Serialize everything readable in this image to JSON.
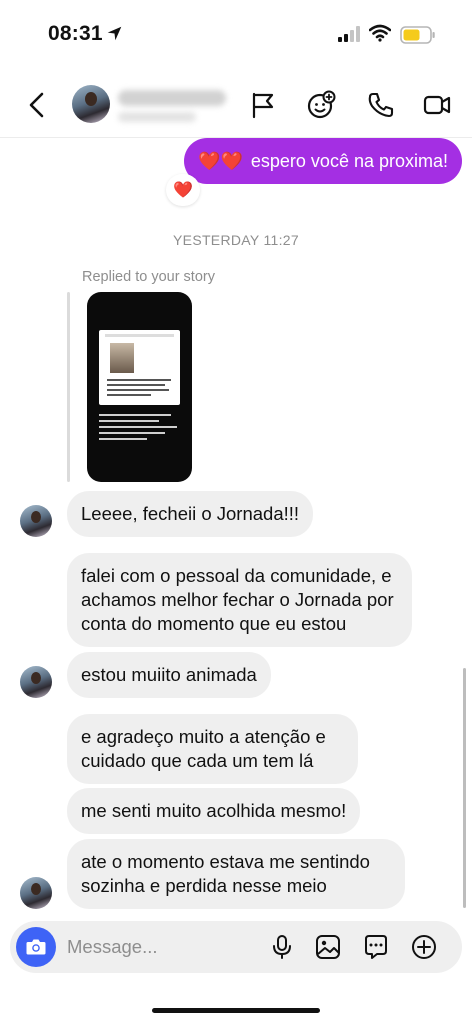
{
  "status": {
    "time": "08:31"
  },
  "header": {
    "back_label": "back"
  },
  "messages": {
    "sent_text": "espero você na proxima!",
    "sent_hearts": "❤️❤️",
    "reaction": "❤️",
    "timestamp": "YESTERDAY 11:27",
    "replied_label": "Replied to your story",
    "received": [
      "Leeee, fecheii o Jornada!!!",
      "falei com o pessoal da comunidade, e achamos melhor fechar o Jornada por conta do momento que eu estou",
      "estou muiito animada",
      "e agradeço muito a atenção e cuidado que cada um tem lá",
      "me senti muito acolhida mesmo!",
      "ate o momento estava me sentindo sozinha e perdida nesse meio"
    ]
  },
  "composer": {
    "placeholder": "Message..."
  },
  "colors": {
    "sent_bubble": "#a42fe3",
    "received_bubble": "#efefef",
    "camera_button": "#3e63f6"
  },
  "icons": [
    "back-icon",
    "flag-icon",
    "face-plus-icon",
    "phone-icon",
    "video-icon",
    "camera-icon",
    "mic-icon",
    "gallery-icon",
    "sticker-icon",
    "plus-icon"
  ]
}
